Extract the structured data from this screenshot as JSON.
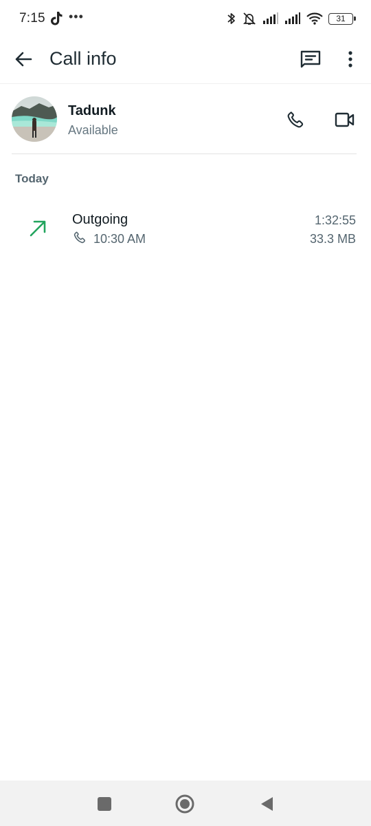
{
  "status_bar": {
    "time": "7:15",
    "icons_left": [
      "tiktok-icon",
      "more-notifications-icon"
    ],
    "icons_right": [
      "bluetooth-icon",
      "vibrate-off-icon",
      "signal-icon",
      "signal-icon",
      "wifi-icon",
      "battery-icon"
    ],
    "battery_level": "31"
  },
  "app_bar": {
    "title": "Call info",
    "back_icon": "arrow-back-icon",
    "message_icon": "message-icon",
    "more_icon": "more-vert-icon"
  },
  "contact": {
    "name": "Tadunk",
    "status": "Available",
    "avatar_icon": "avatar-photo",
    "voice_call_icon": "phone-icon",
    "video_call_icon": "video-camera-icon"
  },
  "section": {
    "label": "Today"
  },
  "calls": [
    {
      "type": "Outgoing",
      "direction_icon": "outgoing-arrow-icon",
      "time": "10:30 AM",
      "duration": "1:32:55",
      "size": "33.3 MB"
    }
  ],
  "nav_bar": {
    "recents_icon": "square-icon",
    "home_icon": "circle-icon",
    "back_icon": "triangle-back-icon"
  },
  "colors": {
    "outgoing_arrow": "#21a45d",
    "text_primary": "#111b21",
    "text_secondary": "#667781",
    "nav_bg": "#f2f2f2"
  }
}
